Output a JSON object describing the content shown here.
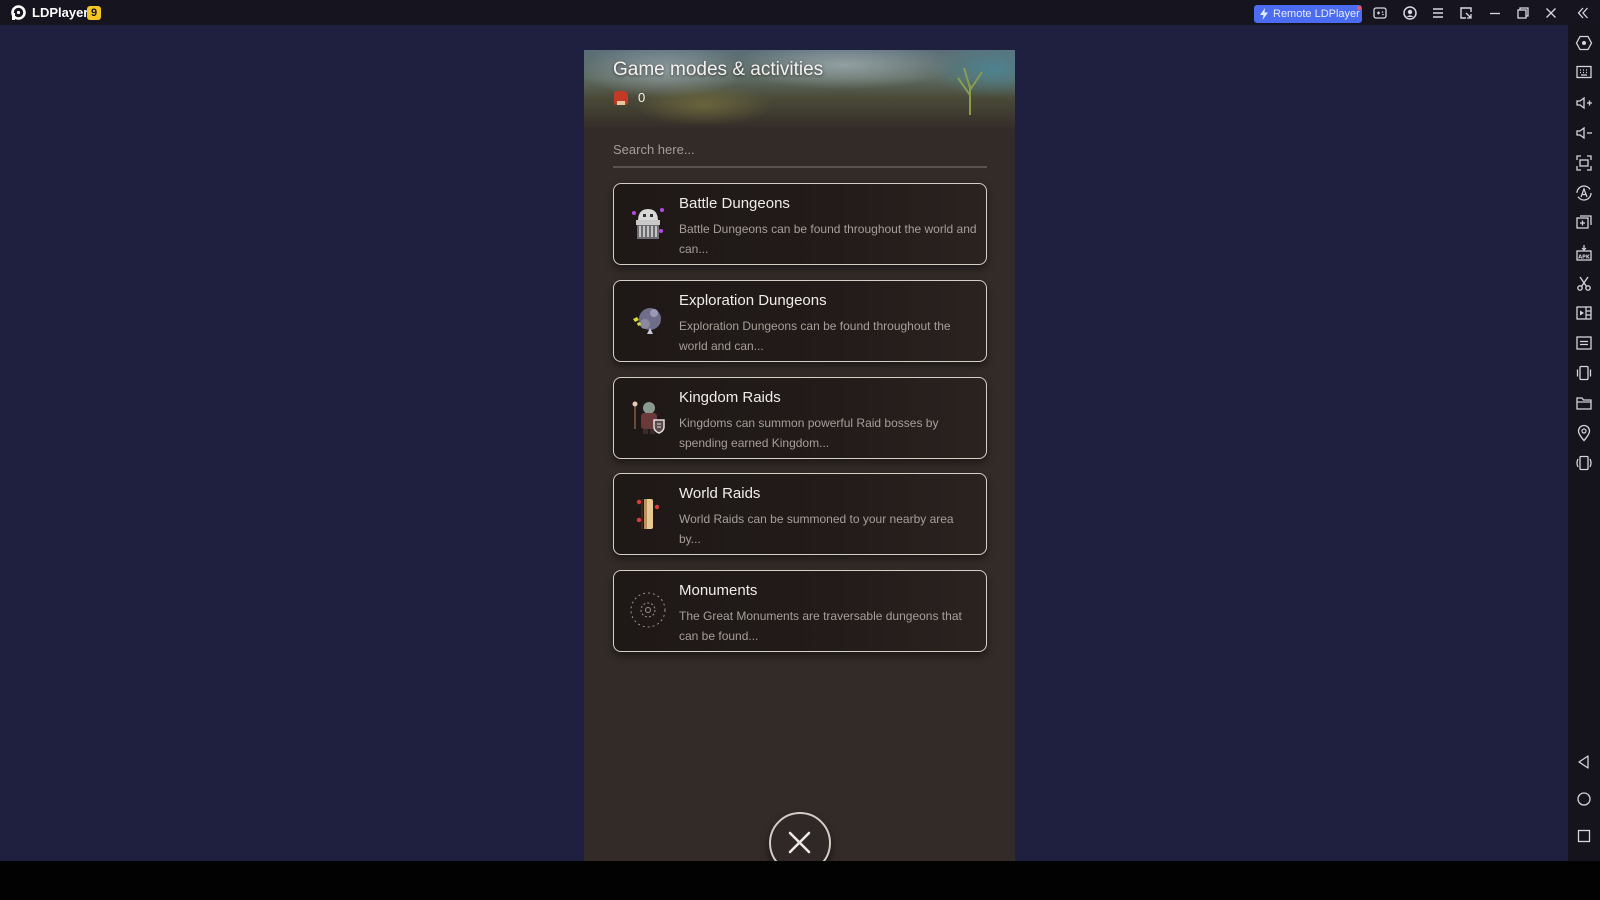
{
  "app": {
    "name": "LDPlayer",
    "badge": "9",
    "remote_button_label": "Remote LDPlayer"
  },
  "titlebar_icons": [
    "gamepad-icon",
    "account-icon",
    "menu-icon",
    "window-sync-icon",
    "minimize-icon",
    "restore-icon",
    "close-icon",
    "collapse-sidebar-icon"
  ],
  "sidebar_icons": [
    "settings-hex-icon",
    "keyboard-icon",
    "volume-up-icon",
    "volume-down-icon",
    "screenshot-fullscreen-icon",
    "auto-click-icon",
    "add-window-icon",
    "apk-install-icon",
    "scissors-icon",
    "video-record-icon",
    "sync-text-icon",
    "shake-icon",
    "folder-icon",
    "location-icon",
    "rotate-icon"
  ],
  "nav_icons": [
    "back-icon",
    "home-icon",
    "recents-icon"
  ],
  "panel": {
    "title": "Game modes & activities",
    "currency_value": "0",
    "search_placeholder": "Search here...",
    "search_value": "",
    "items": [
      {
        "title": "Battle Dungeons",
        "description": "Battle Dungeons can be found throughout the world and can...",
        "icon": "battle-dungeon-icon"
      },
      {
        "title": "Exploration Dungeons",
        "description": "Exploration Dungeons can be found throughout the world and can...",
        "icon": "exploration-dungeon-icon"
      },
      {
        "title": "Kingdom Raids",
        "description": "Kingdoms can summon powerful Raid bosses by spending earned Kingdom...",
        "icon": "kingdom-raid-icon"
      },
      {
        "title": "World Raids",
        "description": "World Raids can be summoned to your nearby area by...",
        "icon": "world-raid-icon"
      },
      {
        "title": "Monuments",
        "description": "The Great Monuments are traversable dungeons that can be found...",
        "icon": "monument-icon"
      }
    ]
  },
  "colors": {
    "accent_remote": "#4b6cf0",
    "badge": "#f3c623",
    "panel_bg": "#332b28",
    "emulator_bg": "#1f2040"
  }
}
